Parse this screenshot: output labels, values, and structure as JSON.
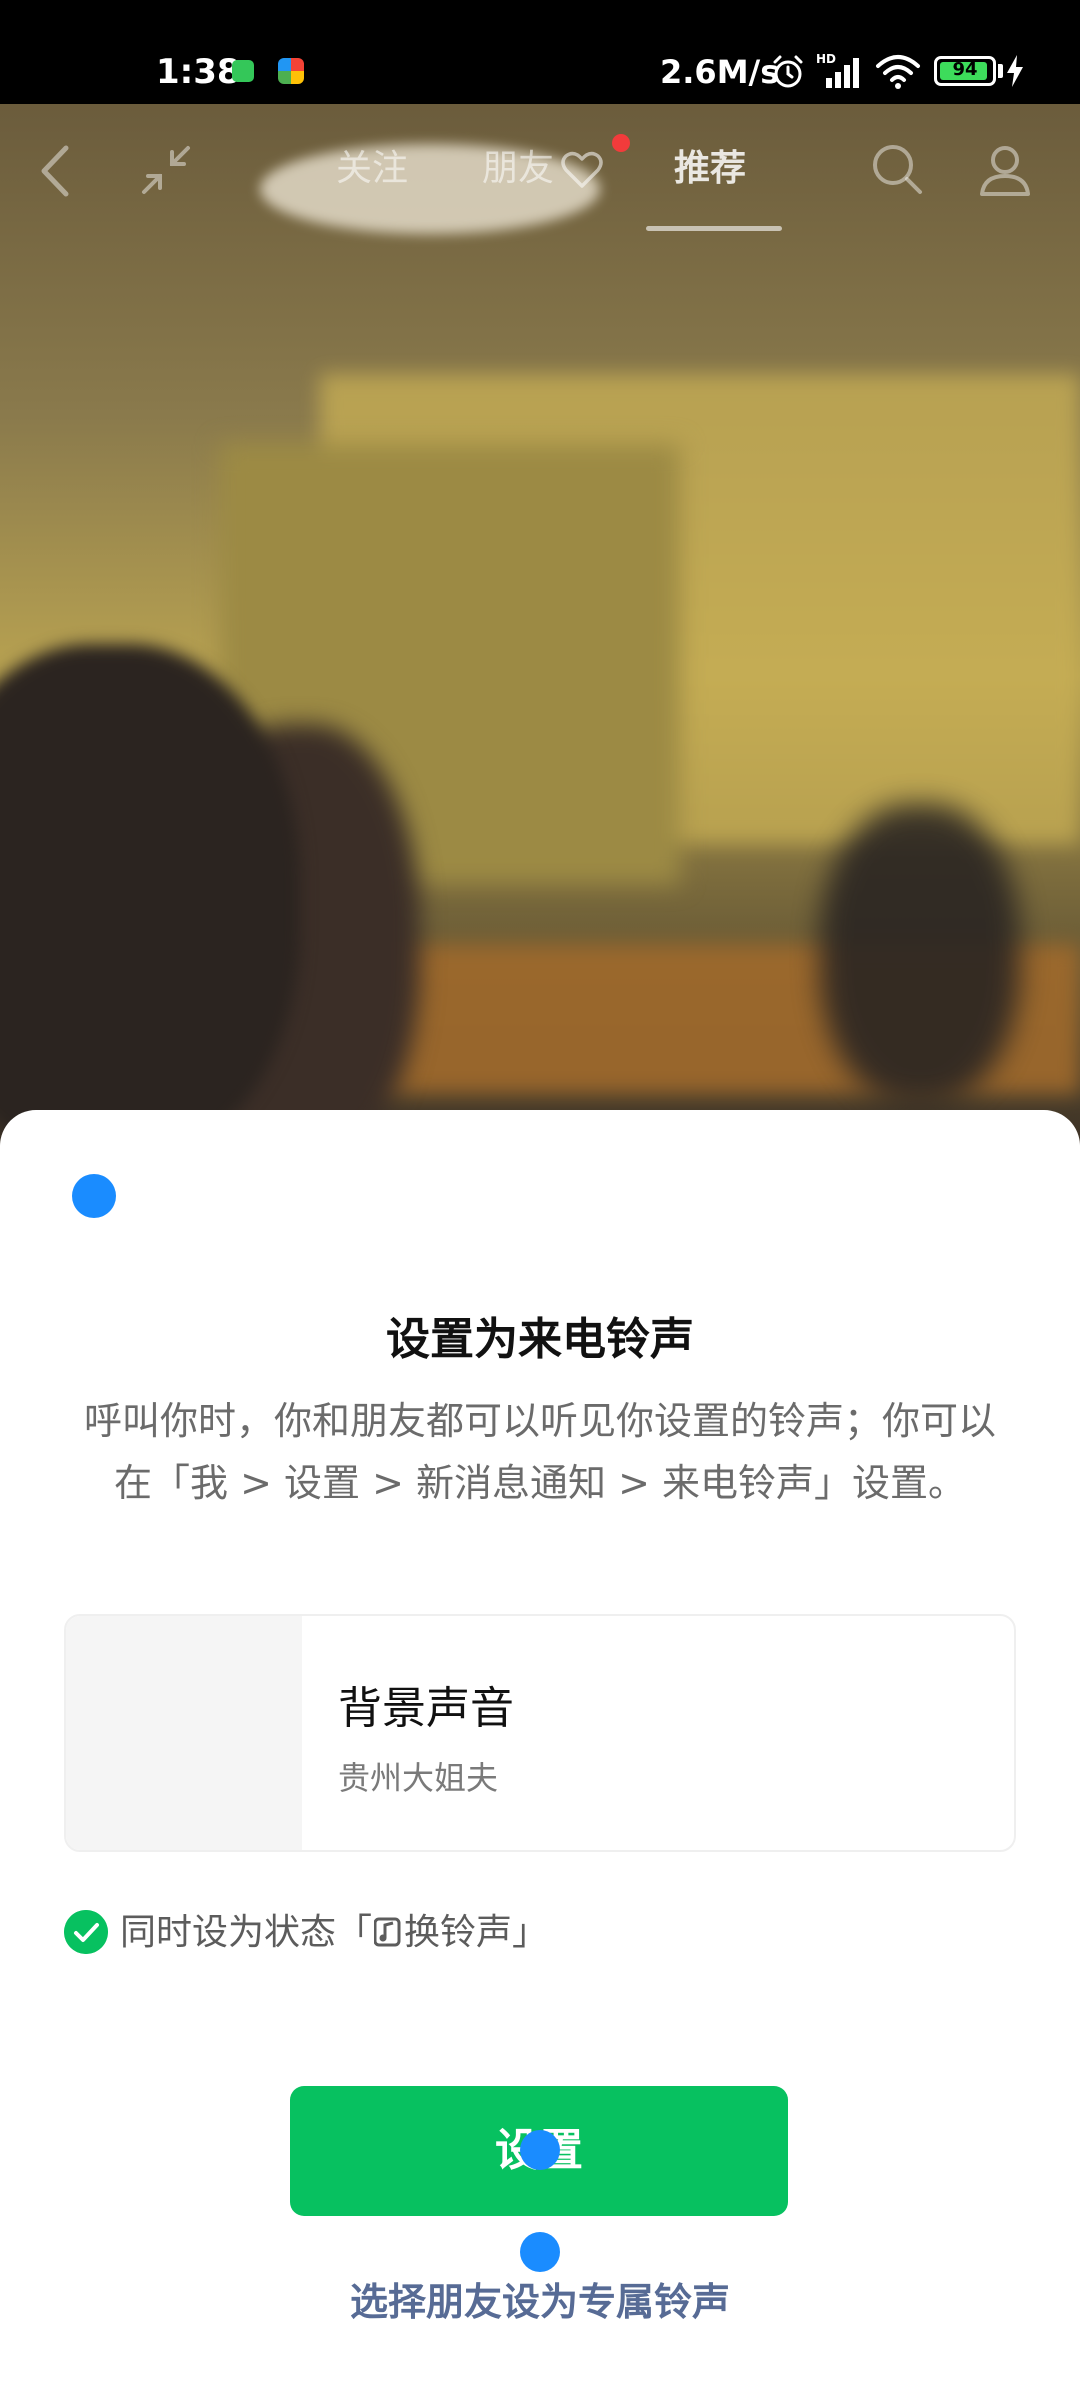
{
  "status_bar": {
    "time": "1:38",
    "network_speed": "2.6M/s",
    "hd_badge": "HD",
    "battery_level": "94",
    "battery_fraction": 0.94,
    "icons": [
      "app-notification-icon",
      "app-notification-icon-2",
      "alarm-icon",
      "signal-icon",
      "wifi-icon",
      "battery-icon",
      "charging-icon"
    ]
  },
  "nav": {
    "tabs": [
      {
        "label": "关注",
        "selected": false
      },
      {
        "label": "朋友",
        "selected": false
      },
      {
        "label": "推荐",
        "selected": true
      }
    ],
    "icons": [
      "back-icon",
      "shrink-icon",
      "heart-icon",
      "search-icon",
      "profile-icon"
    ]
  },
  "sheet": {
    "title": "设置为来电铃声",
    "description": "呼叫你时，你和朋友都可以听见你设置的铃声；你可以在「我 > 设置 > 新消息通知 > 来电铃声」设置。",
    "music": {
      "title": "背景声音",
      "artist": "贵州大姐夫"
    },
    "status_option": {
      "checked": true,
      "label_prefix": "同时设为状态「",
      "label_suffix": "换铃声」"
    },
    "set_button_label": "设置",
    "friend_link_label": "选择朋友设为专属铃声"
  },
  "colors": {
    "accent_green": "#07c160",
    "link_blue": "#576b95",
    "touch_marker": "#1a8cff",
    "notification_dot": "#f23b3b"
  }
}
